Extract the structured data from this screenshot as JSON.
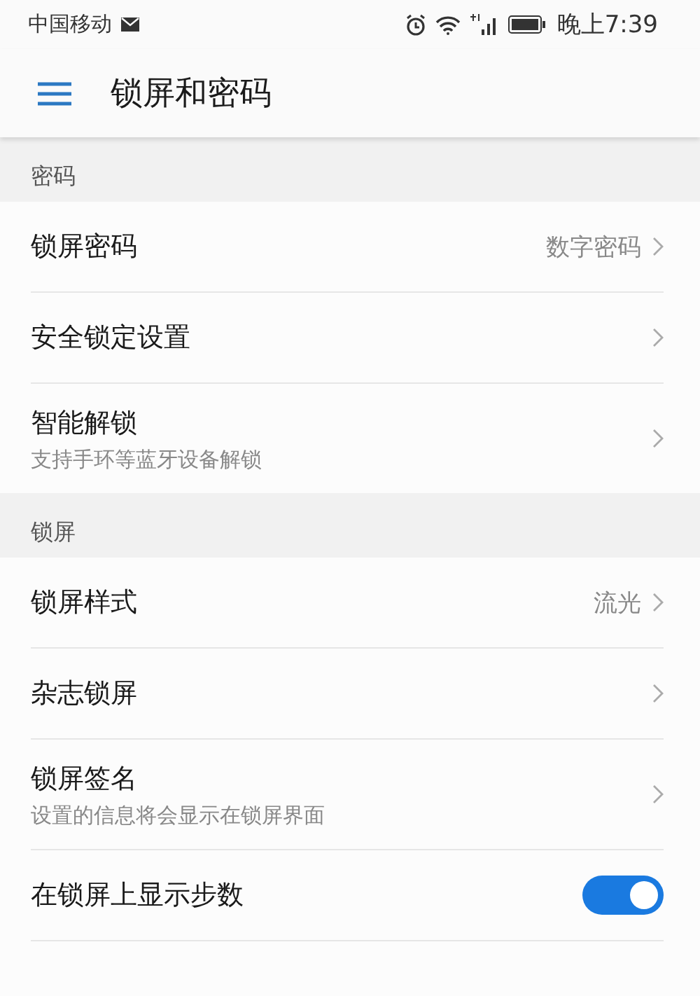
{
  "status_bar": {
    "carrier": "中国移动",
    "time": "晚上7:39"
  },
  "app_bar": {
    "title": "锁屏和密码"
  },
  "sections": [
    {
      "header": "密码",
      "items": [
        {
          "kind": "link",
          "title": "锁屏密码",
          "value": "数字密码"
        },
        {
          "kind": "link",
          "title": "安全锁定设置"
        },
        {
          "kind": "link",
          "title": "智能解锁",
          "subtitle": "支持手环等蓝牙设备解锁"
        }
      ]
    },
    {
      "header": "锁屏",
      "items": [
        {
          "kind": "link",
          "title": "锁屏样式",
          "value": "流光"
        },
        {
          "kind": "link",
          "title": "杂志锁屏"
        },
        {
          "kind": "link",
          "title": "锁屏签名",
          "subtitle": "设置的信息将会显示在锁屏界面"
        },
        {
          "kind": "toggle",
          "title": "在锁屏上显示步数",
          "on": true
        }
      ]
    }
  ]
}
